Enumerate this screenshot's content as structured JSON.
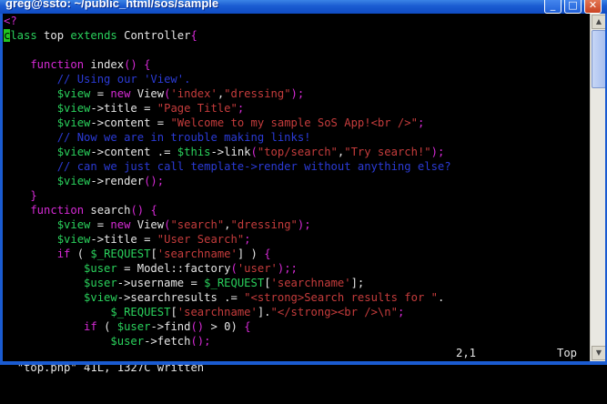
{
  "window": {
    "title": "greg@ssto: ~/public_html/sos/sample",
    "buttons": {
      "minimize": "_",
      "maximize": "□",
      "close": "✕"
    },
    "accent_color": "#1a5bd1"
  },
  "editor": {
    "theme": {
      "background": "#000000",
      "keyword": "#d62ad6",
      "type": "#2ad15c",
      "plain": "#e6e6e6",
      "string": "#c53c3c",
      "comment": "#2b3bd6"
    },
    "lines": [
      [
        {
          "t": "<?",
          "c": "k"
        }
      ],
      [
        {
          "t": "c",
          "c": "cursor"
        },
        {
          "t": "lass",
          "c": "g"
        },
        {
          "t": " top ",
          "c": "w"
        },
        {
          "t": "extends",
          "c": "g"
        },
        {
          "t": " Controller",
          "c": "w"
        },
        {
          "t": "{",
          "c": "k"
        }
      ],
      [],
      [
        {
          "t": "    function",
          "c": "k"
        },
        {
          "t": " index",
          "c": "w"
        },
        {
          "t": "() {",
          "c": "k"
        }
      ],
      [
        {
          "t": "        // Using our 'View'.",
          "c": "c"
        }
      ],
      [
        {
          "t": "        $view",
          "c": "g"
        },
        {
          "t": " = ",
          "c": "w"
        },
        {
          "t": "new",
          "c": "k"
        },
        {
          "t": " View",
          "c": "w"
        },
        {
          "t": "(",
          "c": "k"
        },
        {
          "t": "'index'",
          "c": "s"
        },
        {
          "t": ",",
          "c": "w"
        },
        {
          "t": "\"dressing\"",
          "c": "s"
        },
        {
          "t": ");",
          "c": "k"
        }
      ],
      [
        {
          "t": "        $view",
          "c": "g"
        },
        {
          "t": "->title = ",
          "c": "w"
        },
        {
          "t": "\"Page Title\"",
          "c": "s"
        },
        {
          "t": ";",
          "c": "k"
        }
      ],
      [
        {
          "t": "        $view",
          "c": "g"
        },
        {
          "t": "->content = ",
          "c": "w"
        },
        {
          "t": "\"Welcome to my sample SoS App!<br />\"",
          "c": "s"
        },
        {
          "t": ";",
          "c": "k"
        }
      ],
      [
        {
          "t": "        // Now we are in trouble making links!",
          "c": "c"
        }
      ],
      [
        {
          "t": "        $view",
          "c": "g"
        },
        {
          "t": "->content .= ",
          "c": "w"
        },
        {
          "t": "$this",
          "c": "g"
        },
        {
          "t": "->link",
          "c": "w"
        },
        {
          "t": "(",
          "c": "k"
        },
        {
          "t": "\"top/search\"",
          "c": "s"
        },
        {
          "t": ",",
          "c": "w"
        },
        {
          "t": "\"Try search!\"",
          "c": "s"
        },
        {
          "t": ");",
          "c": "k"
        }
      ],
      [
        {
          "t": "        // can we just call template->render without anything else?",
          "c": "c"
        }
      ],
      [
        {
          "t": "        $view",
          "c": "g"
        },
        {
          "t": "->render",
          "c": "w"
        },
        {
          "t": "();",
          "c": "k"
        }
      ],
      [
        {
          "t": "    }",
          "c": "k"
        }
      ],
      [
        {
          "t": "    function",
          "c": "k"
        },
        {
          "t": " search",
          "c": "w"
        },
        {
          "t": "() {",
          "c": "k"
        }
      ],
      [
        {
          "t": "        $view",
          "c": "g"
        },
        {
          "t": " = ",
          "c": "w"
        },
        {
          "t": "new",
          "c": "k"
        },
        {
          "t": " View",
          "c": "w"
        },
        {
          "t": "(",
          "c": "k"
        },
        {
          "t": "\"search\"",
          "c": "s"
        },
        {
          "t": ",",
          "c": "w"
        },
        {
          "t": "\"dressing\"",
          "c": "s"
        },
        {
          "t": ");",
          "c": "k"
        }
      ],
      [
        {
          "t": "        $view",
          "c": "g"
        },
        {
          "t": "->title = ",
          "c": "w"
        },
        {
          "t": "\"User Search\"",
          "c": "s"
        },
        {
          "t": ";",
          "c": "k"
        }
      ],
      [
        {
          "t": "        if",
          "c": "k"
        },
        {
          "t": " ( ",
          "c": "w"
        },
        {
          "t": "$_REQUEST",
          "c": "g"
        },
        {
          "t": "[",
          "c": "w"
        },
        {
          "t": "'searchname'",
          "c": "s"
        },
        {
          "t": "] ) ",
          "c": "w"
        },
        {
          "t": "{",
          "c": "k"
        }
      ],
      [
        {
          "t": "            $user",
          "c": "g"
        },
        {
          "t": " = Model::factory",
          "c": "w"
        },
        {
          "t": "(",
          "c": "k"
        },
        {
          "t": "'user'",
          "c": "s"
        },
        {
          "t": ");;",
          "c": "k"
        }
      ],
      [
        {
          "t": "            $user",
          "c": "g"
        },
        {
          "t": "->username = ",
          "c": "w"
        },
        {
          "t": "$_REQUEST",
          "c": "g"
        },
        {
          "t": "[",
          "c": "w"
        },
        {
          "t": "'searchname'",
          "c": "s"
        },
        {
          "t": "];",
          "c": "w"
        }
      ],
      [
        {
          "t": "            $view",
          "c": "g"
        },
        {
          "t": "->searchresults .= ",
          "c": "w"
        },
        {
          "t": "\"<strong>Search results for \"",
          "c": "s"
        },
        {
          "t": ".",
          "c": "w"
        }
      ],
      [
        {
          "t": "                $_REQUEST",
          "c": "g"
        },
        {
          "t": "[",
          "c": "w"
        },
        {
          "t": "'searchname'",
          "c": "s"
        },
        {
          "t": "].",
          "c": "w"
        },
        {
          "t": "\"</strong><br />\\n\"",
          "c": "s"
        },
        {
          "t": ";",
          "c": "k"
        }
      ],
      [
        {
          "t": "            if",
          "c": "k"
        },
        {
          "t": " ( ",
          "c": "w"
        },
        {
          "t": "$user",
          "c": "g"
        },
        {
          "t": "->find",
          "c": "w"
        },
        {
          "t": "()",
          "c": "k"
        },
        {
          "t": " > 0) ",
          "c": "w"
        },
        {
          "t": "{",
          "c": "k"
        }
      ],
      [
        {
          "t": "                $user",
          "c": "g"
        },
        {
          "t": "->fetch",
          "c": "w"
        },
        {
          "t": "();",
          "c": "k"
        }
      ]
    ]
  },
  "status": {
    "message": "\"top.php\" 41L, 1327C written",
    "position": "2,1",
    "scroll": "Top"
  },
  "scrollbar": {
    "up_icon": "▲",
    "down_icon": "▼",
    "position": 0
  }
}
